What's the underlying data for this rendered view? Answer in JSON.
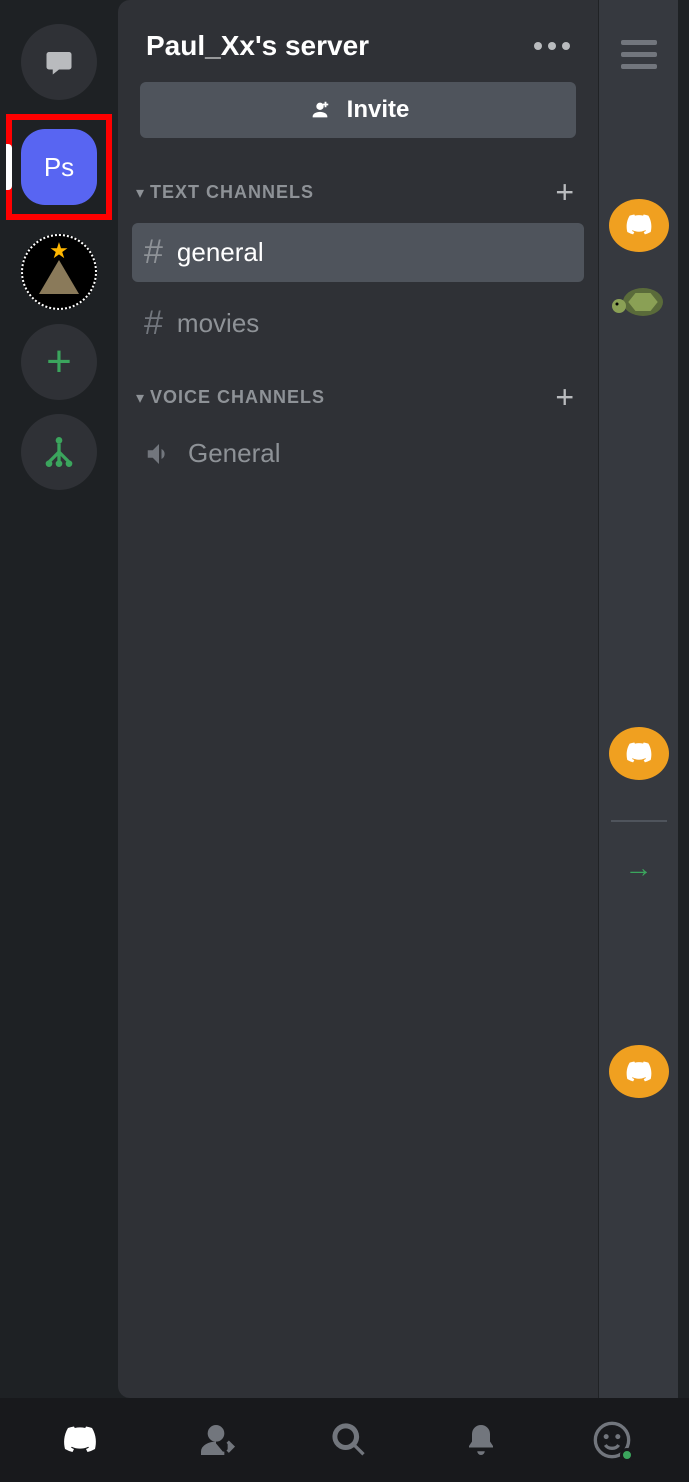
{
  "header": {
    "server_title": "Paul_Xx's server"
  },
  "invite": {
    "label": "Invite"
  },
  "server_rail": {
    "selected_initials": "Ps"
  },
  "categories": {
    "text": {
      "label": "TEXT CHANNELS",
      "channels": [
        {
          "name": "general",
          "active": true
        },
        {
          "name": "movies",
          "active": false
        }
      ]
    },
    "voice": {
      "label": "VOICE CHANNELS",
      "channels": [
        {
          "name": "General"
        }
      ]
    }
  }
}
